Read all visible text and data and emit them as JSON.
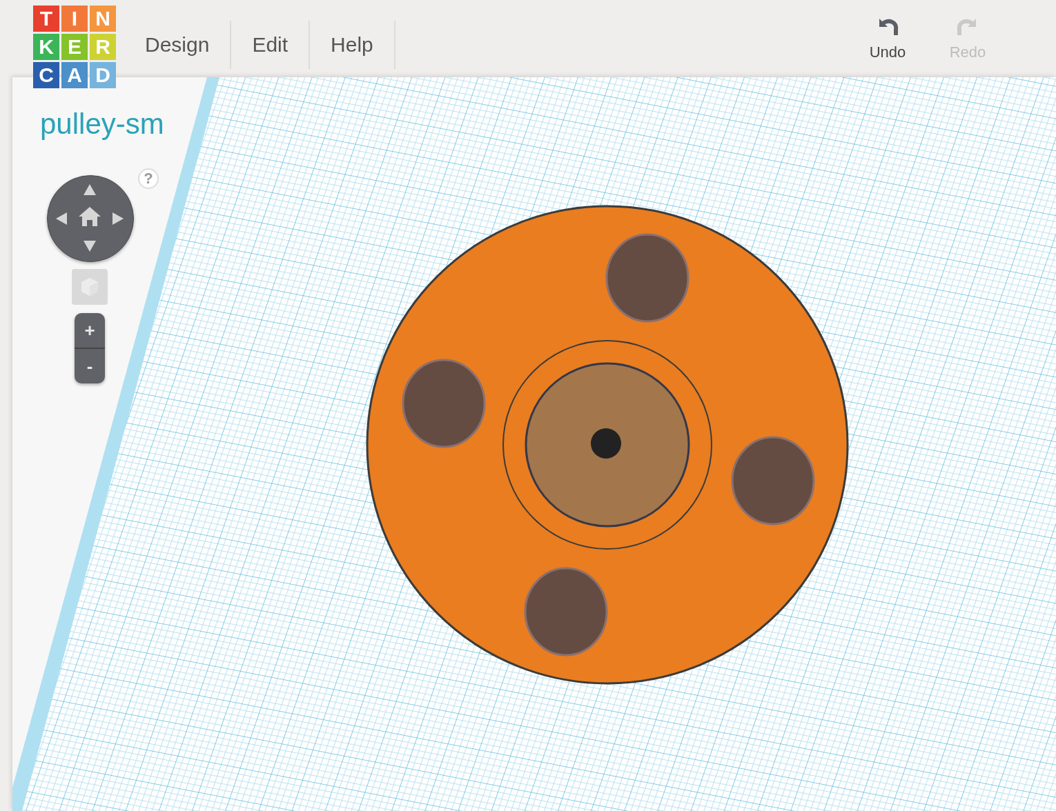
{
  "logo": {
    "tiles": [
      {
        "letter": "T",
        "color": "#e8402e"
      },
      {
        "letter": "I",
        "color": "#f2783a"
      },
      {
        "letter": "N",
        "color": "#f49640"
      },
      {
        "letter": "K",
        "color": "#3bb558"
      },
      {
        "letter": "E",
        "color": "#84c32a"
      },
      {
        "letter": "R",
        "color": "#cdd232"
      },
      {
        "letter": "C",
        "color": "#2a5fae"
      },
      {
        "letter": "A",
        "color": "#4b90c9"
      },
      {
        "letter": "D",
        "color": "#76b4dd"
      }
    ]
  },
  "menu": [
    {
      "label": "Design"
    },
    {
      "label": "Edit"
    },
    {
      "label": "Help"
    }
  ],
  "history": [
    {
      "label": "Undo",
      "kind": "undo",
      "disabled": false
    },
    {
      "label": "Redo",
      "kind": "redo",
      "disabled": true
    }
  ],
  "design_title": "pulley-sm",
  "help_button": "?",
  "zoom": {
    "plus": "+",
    "minus": "-"
  }
}
